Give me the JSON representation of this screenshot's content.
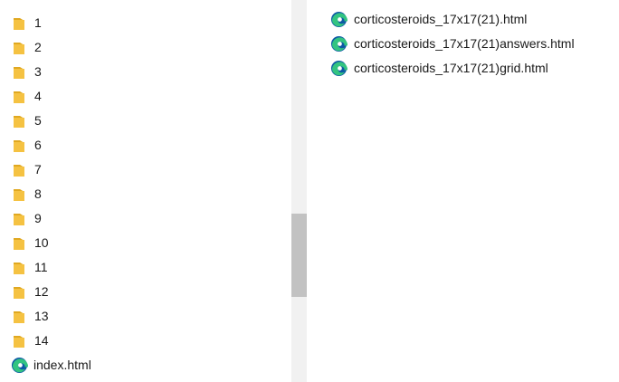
{
  "nav": {
    "items": [
      {
        "label": "1",
        "icon": "folder-icon"
      },
      {
        "label": "2",
        "icon": "folder-icon"
      },
      {
        "label": "3",
        "icon": "folder-icon"
      },
      {
        "label": "4",
        "icon": "folder-icon"
      },
      {
        "label": "5",
        "icon": "folder-icon"
      },
      {
        "label": "6",
        "icon": "folder-icon"
      },
      {
        "label": "7",
        "icon": "folder-icon"
      },
      {
        "label": "8",
        "icon": "folder-icon"
      },
      {
        "label": "9",
        "icon": "folder-icon"
      },
      {
        "label": "10",
        "icon": "folder-icon"
      },
      {
        "label": "11",
        "icon": "folder-icon"
      },
      {
        "label": "12",
        "icon": "folder-icon"
      },
      {
        "label": "13",
        "icon": "folder-icon"
      },
      {
        "label": "14",
        "icon": "folder-icon"
      },
      {
        "label": "index.html",
        "icon": "edge-icon"
      }
    ]
  },
  "files": {
    "items": [
      {
        "label": "corticosteroids_17x17(21).html",
        "icon": "edge-icon"
      },
      {
        "label": "corticosteroids_17x17(21)answers.html",
        "icon": "edge-icon"
      },
      {
        "label": "corticosteroids_17x17(21)grid.html",
        "icon": "edge-icon"
      }
    ]
  },
  "colors": {
    "folder": "#f5c242",
    "folder_dark": "#e0a820",
    "edge_blue": "#0c59a4",
    "edge_green": "#33c481",
    "text": "#1a1a1a",
    "scroll_track": "#f1f1f1",
    "scroll_thumb": "#c2c2c2"
  }
}
